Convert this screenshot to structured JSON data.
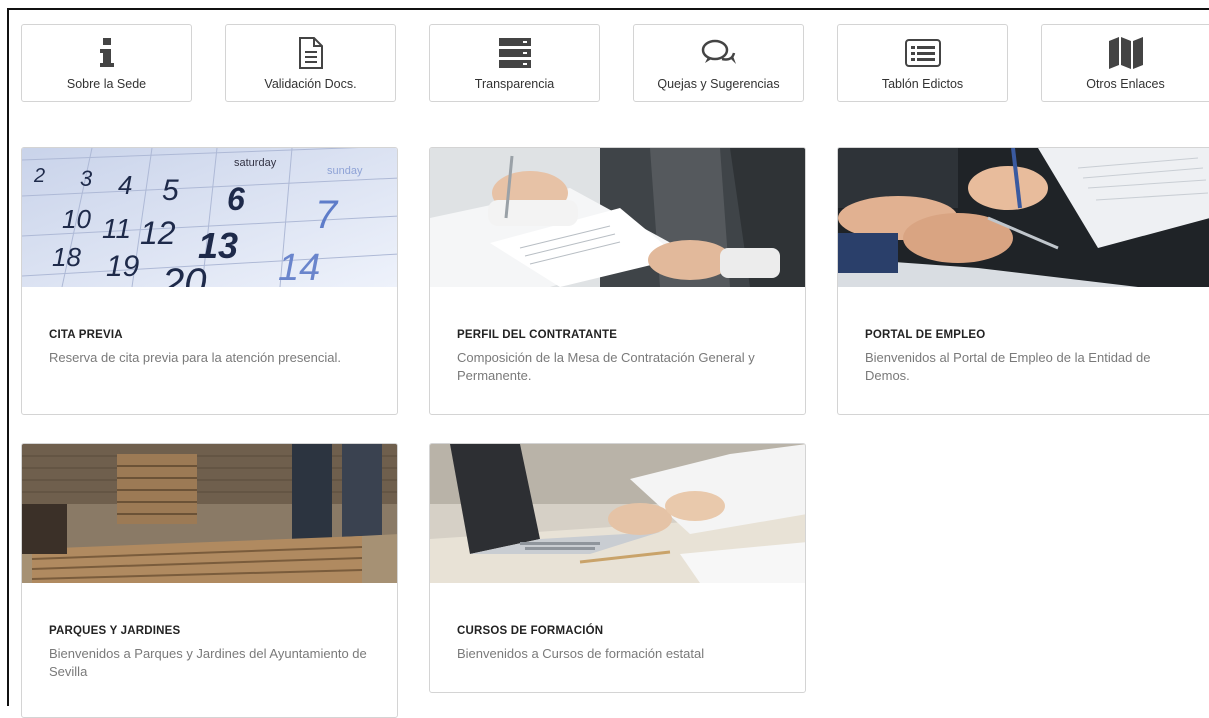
{
  "quick_links": [
    {
      "label": "Sobre la Sede",
      "icon": "info-icon"
    },
    {
      "label": "Validación Docs.",
      "icon": "document-icon"
    },
    {
      "label": "Transparencia",
      "icon": "server-icon"
    },
    {
      "label": "Quejas y Sugerencias",
      "icon": "chat-bubbles-icon"
    },
    {
      "label": "Tablón Edictos",
      "icon": "list-board-icon"
    },
    {
      "label": "Otros Enlaces",
      "icon": "map-icon"
    }
  ],
  "cards": [
    {
      "title": "CITA PREVIA",
      "description": "Reserva de cita previa para la atención presencial.",
      "image": "calendar-image"
    },
    {
      "title": "PERFIL DEL CONTRATANTE",
      "description": "Composición de la Mesa de Contratación General y Permanente.",
      "image": "business-documents-image"
    },
    {
      "title": "PORTAL DE EMPLEO",
      "description": "Bienvenidos al Portal de Empleo de la Entidad de Demos.",
      "image": "handshake-papers-image"
    },
    {
      "title": "PARQUES Y JARDINES",
      "description": "Bienvenidos a Parques y Jardines del Ayuntamiento de Sevilla",
      "image": "park-bench-image"
    },
    {
      "title": "CURSOS DE FORMACIÓN",
      "description": "Bienvenidos a Cursos de formación estatal",
      "image": "laptop-image"
    }
  ],
  "calendar": {
    "days": [
      "saturday",
      "sunday"
    ],
    "numbers": [
      "2",
      "3",
      "4",
      "5",
      "6",
      "7",
      "10",
      "11",
      "12",
      "13",
      "14",
      "18",
      "19",
      "20"
    ]
  },
  "colors": {
    "border": "#d4d4d4",
    "icon": "#444444",
    "title": "#222222",
    "description": "#7a7a7a"
  }
}
